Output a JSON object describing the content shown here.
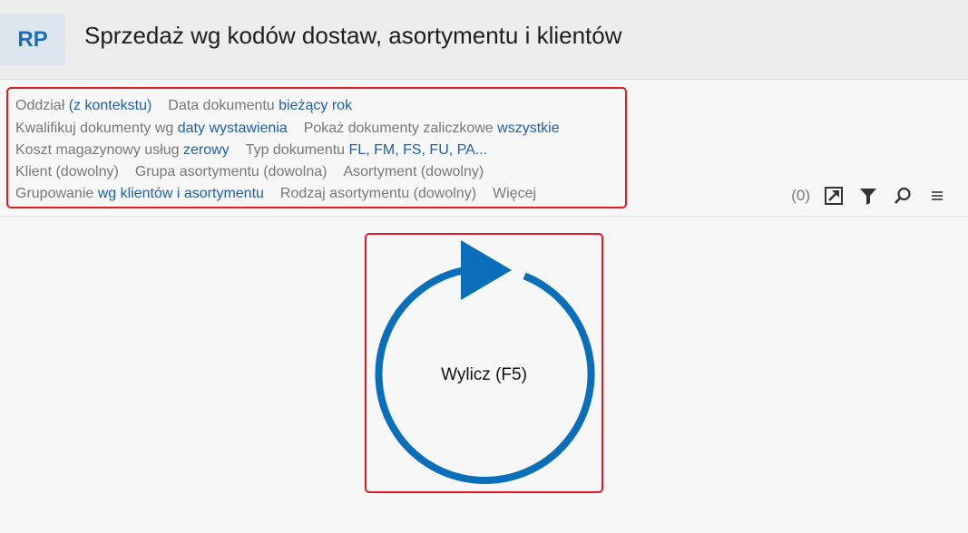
{
  "header": {
    "badge": "RP",
    "title": "Sprzedaż wg kodów dostaw, asortymentu i klientów"
  },
  "params": {
    "row1": {
      "p1_label": "Oddział",
      "p1_value": "(z kontekstu)",
      "p2_label": "Data dokumentu",
      "p2_value": "bieżący rok"
    },
    "row2": {
      "p1_label": "Kwalifikuj dokumenty wg",
      "p1_value": "daty wystawienia",
      "p2_label": "Pokaż dokumenty zaliczkowe",
      "p2_value": "wszystkie"
    },
    "row3": {
      "p1_label": "Koszt magazynowy usług",
      "p1_value": "zerowy",
      "p2_label": "Typ dokumentu",
      "p2_value": "FL, FM, FS, FU, PA..."
    },
    "row4": {
      "p1": "Klient (dowolny)",
      "p2": "Grupa asortymentu (dowolna)",
      "p3": "Asortyment (dowolny)"
    },
    "row5": {
      "p1_label": "Grupowanie",
      "p1_value": "wg klientów i asortymentu",
      "p2": "Rodzaj asortymentu (dowolny)",
      "more": "Więcej"
    }
  },
  "toolbar": {
    "count": "(0)",
    "icons": [
      "export-icon",
      "filter-icon",
      "search-icon",
      "menu-icon"
    ]
  },
  "calculate": {
    "label": "Wylicz (F5)",
    "color": "#0a6fb8"
  },
  "colors": {
    "value_link": "#1f5fa8",
    "label_gray": "#777777",
    "highlight_border": "#e01b24",
    "badge_bg": "#dde6ee",
    "badge_text": "#1c6fb5"
  }
}
